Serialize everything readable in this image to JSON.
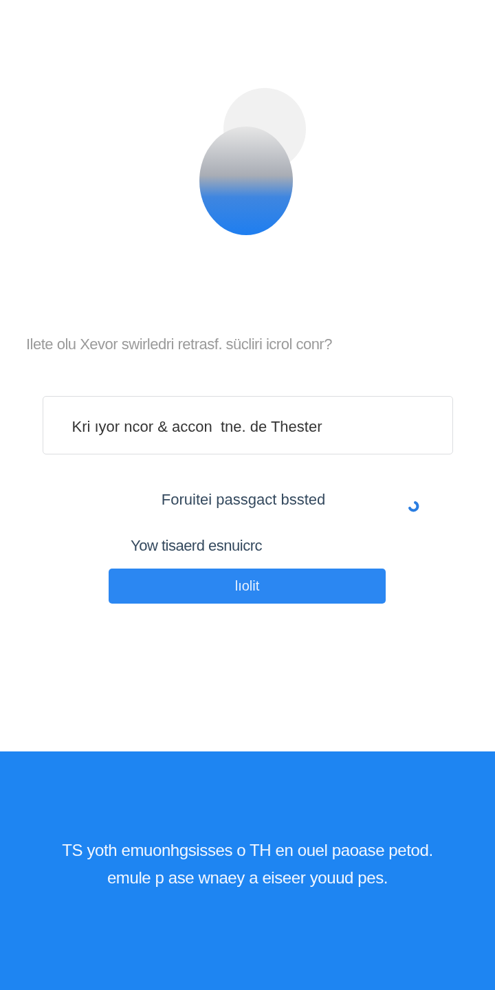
{
  "prompt": "Ilete olu Xevor swirledri  retrasf. sücliri icrol conr?",
  "field": {
    "value": "Kri ıyor ncor & accon  tne. de Thester"
  },
  "link": {
    "label": "Foruitei  passgact bssted"
  },
  "note": "Yow tisaerd  esnuicrc",
  "button": {
    "label": "lıolit"
  },
  "footer": {
    "lines": [
      "TS yoth  emuonhgsisses  o  TH  en ouel  paoase  petod.",
      "emule  p ase  wnaey   a  eiseer  youud  pes."
    ]
  }
}
